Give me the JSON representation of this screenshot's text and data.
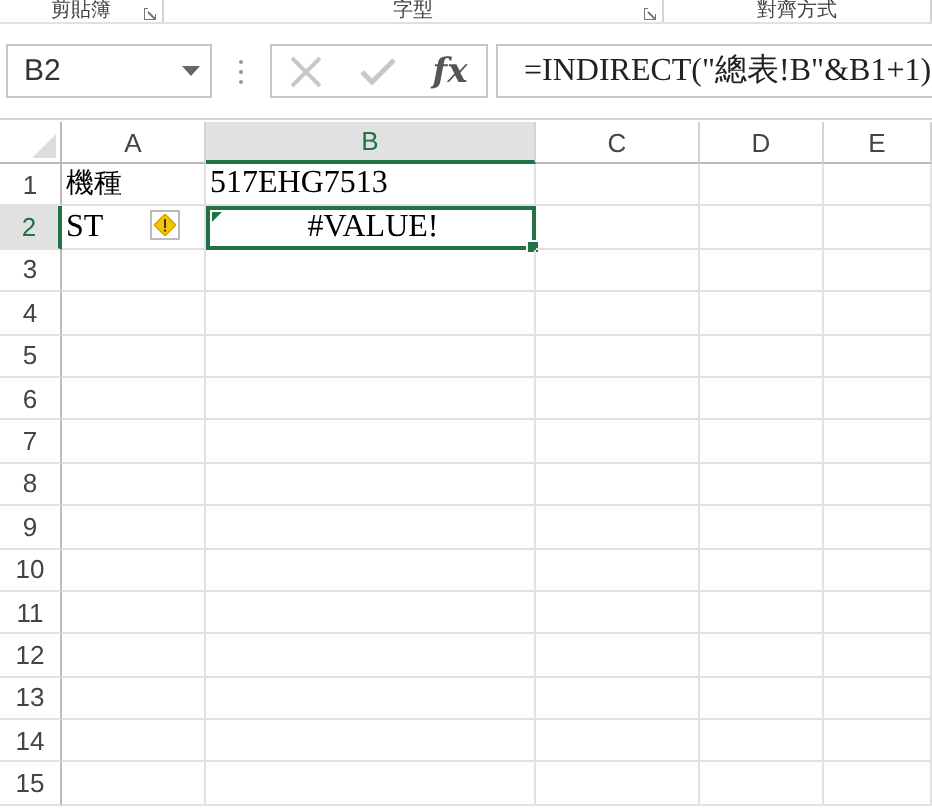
{
  "ribbon_groups": [
    "剪貼簿",
    "字型",
    "對齊方式"
  ],
  "name_box": {
    "value": "B2"
  },
  "formula_bar": {
    "fx": "fx",
    "value": "=INDIRECT(\"總表!B\"&B1+1)"
  },
  "columns": [
    {
      "label": "A",
      "selected": false
    },
    {
      "label": "B",
      "selected": true
    },
    {
      "label": "C",
      "selected": false
    },
    {
      "label": "D",
      "selected": false
    },
    {
      "label": "E",
      "selected": false
    }
  ],
  "rows": [
    {
      "label": "1",
      "selected": false,
      "cells": [
        {
          "text": "機種",
          "selected": false,
          "warning": false
        },
        {
          "text": "517EHG7513",
          "selected": false,
          "warning": false
        }
      ]
    },
    {
      "label": "2",
      "selected": true,
      "cells": [
        {
          "text": "ST",
          "selected": false,
          "warning": true
        },
        {
          "text": "#VALUE!",
          "selected": true,
          "warning": false
        }
      ]
    },
    {
      "label": "3",
      "selected": false,
      "cells": []
    },
    {
      "label": "4",
      "selected": false,
      "cells": []
    },
    {
      "label": "5",
      "selected": false,
      "cells": []
    },
    {
      "label": "6",
      "selected": false,
      "cells": []
    },
    {
      "label": "7",
      "selected": false,
      "cells": []
    },
    {
      "label": "8",
      "selected": false,
      "cells": []
    },
    {
      "label": "9",
      "selected": false,
      "cells": []
    },
    {
      "label": "10",
      "selected": false,
      "cells": []
    },
    {
      "label": "11",
      "selected": false,
      "cells": []
    },
    {
      "label": "12",
      "selected": false,
      "cells": []
    },
    {
      "label": "13",
      "selected": false,
      "cells": []
    },
    {
      "label": "14",
      "selected": false,
      "cells": []
    },
    {
      "label": "15",
      "selected": false,
      "cells": []
    }
  ]
}
